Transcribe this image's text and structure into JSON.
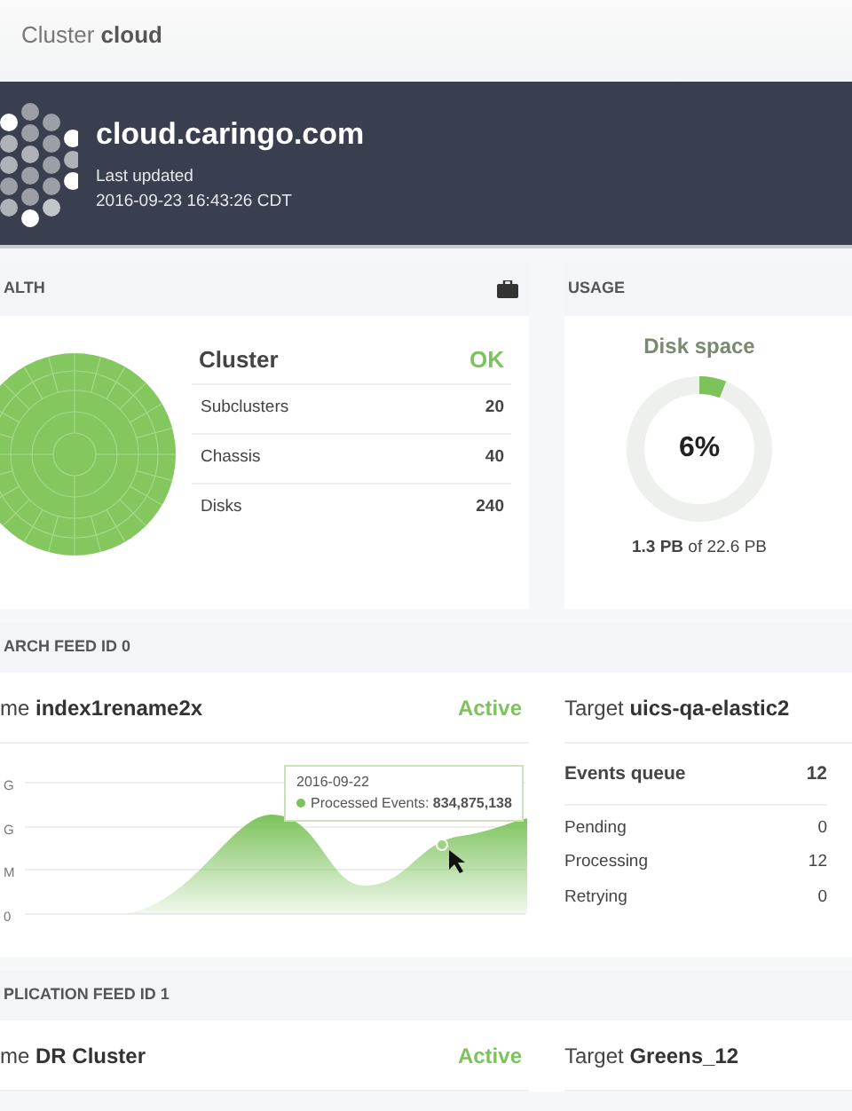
{
  "page_title": "Cluster **cloud**",
  "banner": {
    "hostname": "cloud.caringo.com",
    "last_updated_label": "Last updated",
    "timestamp": "2016-09-23  16:43:26 CDT"
  },
  "health": {
    "header": "ALTH",
    "cluster_label": "Cluster",
    "status": "OK",
    "rows": [
      {
        "label": "Subclusters",
        "value": "20"
      },
      {
        "label": "Chassis",
        "value": "40"
      },
      {
        "label": "Disks",
        "value": "240"
      }
    ]
  },
  "usage": {
    "header": "USAGE",
    "title": "Disk space",
    "percent": "6%",
    "level": 0.06,
    "summary": "**1.3 PB** of 22.6 PB"
  },
  "feeds": [
    {
      "header": "ARCH FEED ID 0",
      "name": "me **index1rename2x**",
      "status": "Active",
      "target": "Target **uics-qa-elastic2**",
      "y_axis_labels": [
        "G",
        "G",
        "M",
        "0"
      ],
      "tooltip": {
        "date": "2016-09-22",
        "text": "Processed Events: **834,875,138**"
      },
      "queue": {
        "label": "Events queue",
        "value": "12",
        "rows": [
          {
            "label": "Pending",
            "value": "0"
          },
          {
            "label": "Processing",
            "value": "12"
          },
          {
            "label": "Retrying",
            "value": "0"
          }
        ]
      }
    },
    {
      "header": "PLICATION FEED ID 1",
      "name": "me **DR Cluster**",
      "status": "Active",
      "target": "Target **Greens_12**"
    }
  ]
}
